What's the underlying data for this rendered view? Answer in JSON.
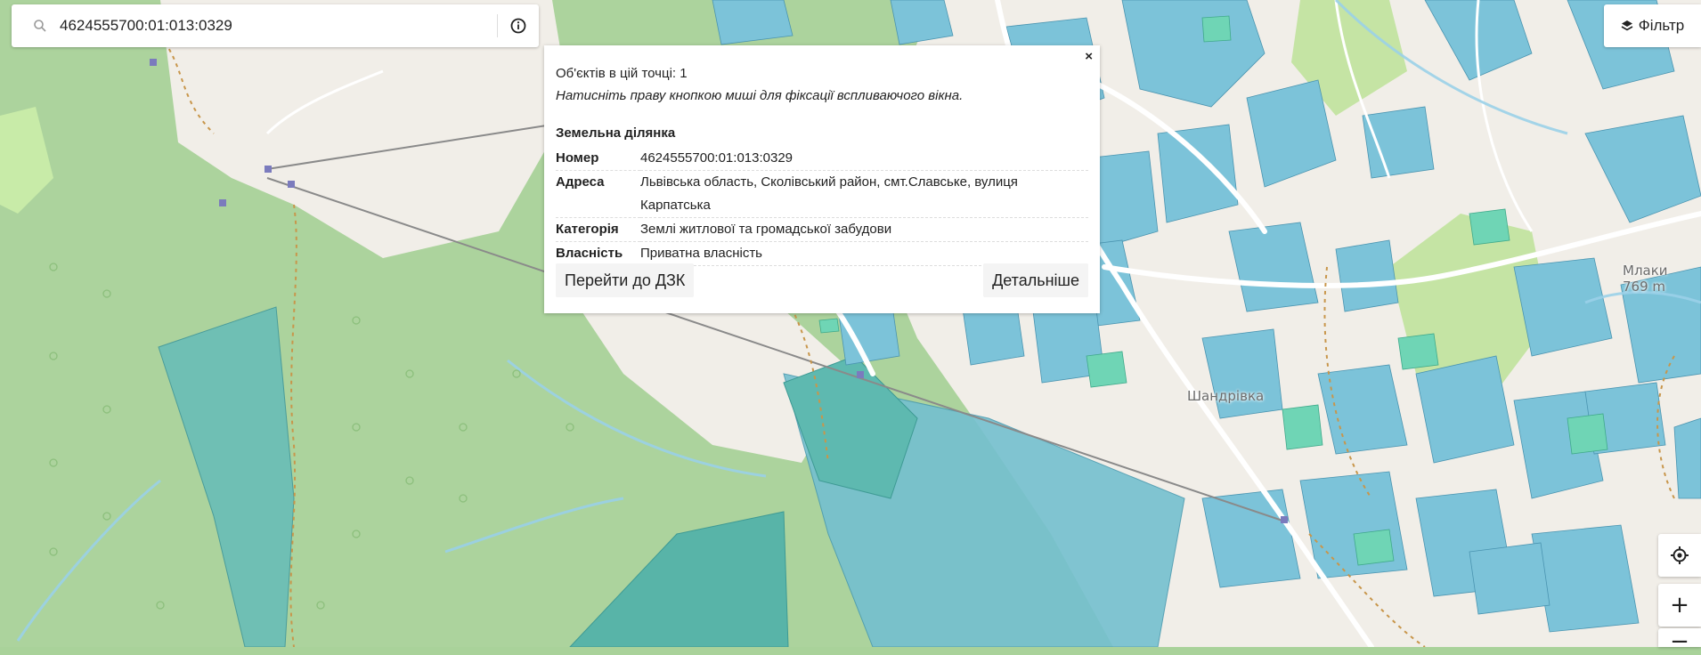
{
  "search": {
    "value": "4624555700:01:013:0329",
    "icon": "search-icon"
  },
  "filter": {
    "label": "Фільтр",
    "icon": "layers-icon"
  },
  "popup": {
    "close_label": "×",
    "count_text": "Об'єктів в цій точці: 1",
    "hint_text": "Натисніть праву кнопкою миші для фіксації вспливаючого вікна.",
    "section_title": "Земельна ділянка",
    "rows": [
      {
        "key": "Номер",
        "value": "4624555700:01:013:0329"
      },
      {
        "key": "Адреса",
        "value": "Львівська область, Сколівський район, смт.Славське, вулиця Карпатська"
      },
      {
        "key": "Категорія",
        "value": "Землі житлової та громадської забудови"
      },
      {
        "key": "Власність",
        "value": "Приватна власність"
      }
    ],
    "goto_button": "Перейти до ДЗК",
    "details_button": "Детальніше"
  },
  "controls": {
    "locate_icon": "locate-icon",
    "zoom_in": "+",
    "zoom_out": "−"
  },
  "map_labels": {
    "mlaky": "Млаки",
    "mlaky_elev": "769 m",
    "shandrivka": "Шандрівка"
  },
  "colors": {
    "forest": "#a9d29a",
    "parcel_blue": "#7cc3d9",
    "parcel_green": "#6fd5b5",
    "road": "#ffffff",
    "track": "#c8964b"
  }
}
